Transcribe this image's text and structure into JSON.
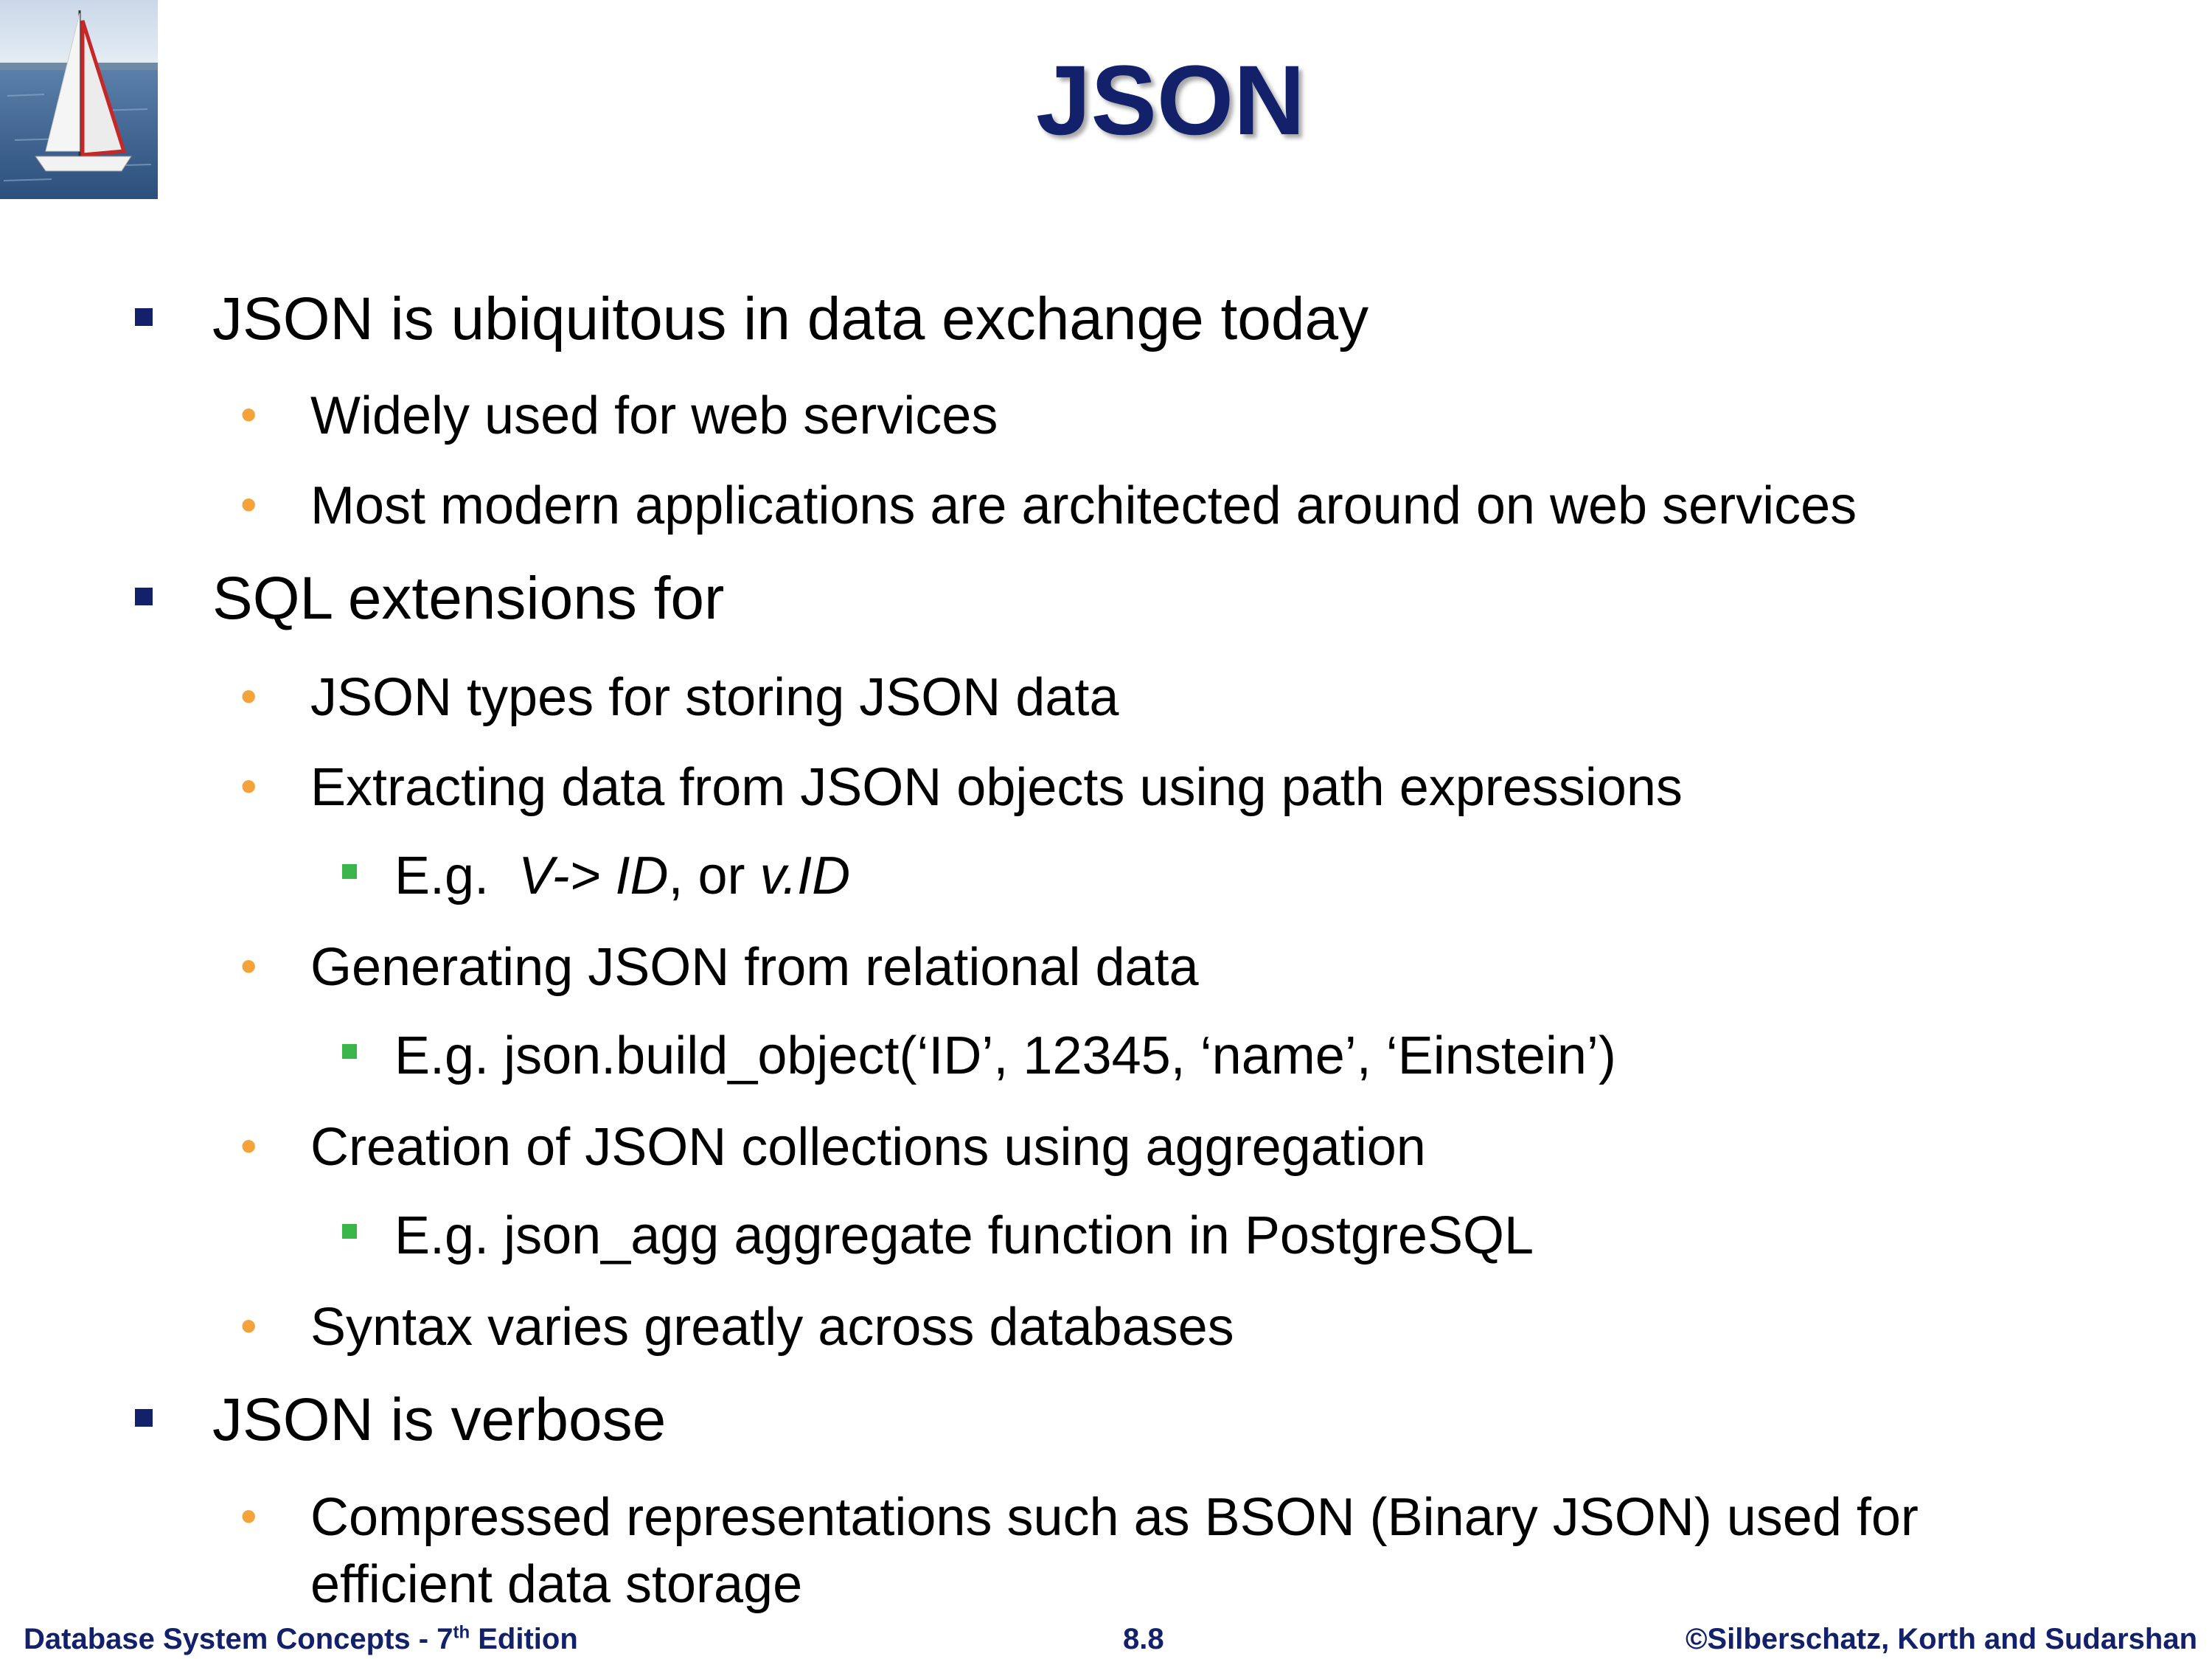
{
  "title": "JSON",
  "bullets": {
    "b1": "JSON is ubiquitous in data exchange today",
    "b1_1": "Widely used for web services",
    "b1_2": "Most modern applications are architected around on web services",
    "b2": "SQL extensions for",
    "b2_1": "JSON types for storing JSON data",
    "b2_2": "Extracting data from JSON objects using path expressions",
    "b2_2_1": {
      "prefix": "E.g.  ",
      "part1": "V-> ID",
      "mid": ", or ",
      "part2": "v.ID"
    },
    "b2_3": "Generating JSON from relational data",
    "b2_3_1": "E.g. json.build_object(‘ID’, 12345, ‘name’, ‘Einstein’)",
    "b2_4": "Creation of JSON collections using aggregation",
    "b2_4_1": "E.g. json_agg aggregate function in PostgreSQL",
    "b2_5": "Syntax varies greatly across databases",
    "b3": "JSON is verbose",
    "b3_1_line1": "Compressed representations such as BSON (Binary JSON) used for",
    "b3_1_line2": "efficient data storage"
  },
  "footer": {
    "left_main": "Database System Concepts - 7",
    "left_sup": "th",
    "left_end": " Edition",
    "center": "8.8",
    "right": "©Silberschatz, Korth and Sudarshan"
  },
  "colors": {
    "title": "#13206a",
    "level1_bullet": "#13206a",
    "level2_bullet": "#f4a23a",
    "level3_bullet": "#39b54a"
  }
}
